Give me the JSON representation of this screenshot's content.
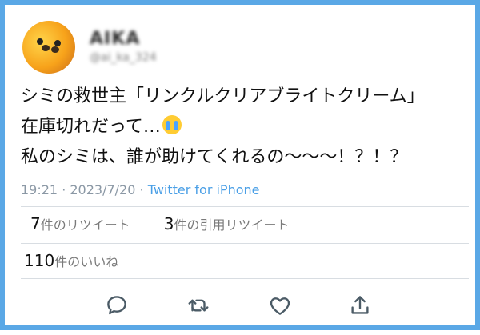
{
  "author": {
    "display_name": "AIKA",
    "handle": "@ai_ka_324"
  },
  "tweet": {
    "line1": "シミの救世主「リンクルクリアブライトクリーム」",
    "line2": "在庫切れだって…",
    "emoji": "loudly-crying-face",
    "line3": "私のシミは、誰が助けてくれるの〜〜〜！？！？"
  },
  "meta": {
    "time": "19:21",
    "date": "2023/7/20",
    "source": "Twitter for iPhone"
  },
  "stats": {
    "retweets_count": "7",
    "retweets_label": "件のリツイート",
    "quotes_count": "3",
    "quotes_label": "件の引用リツイート",
    "likes_count": "110",
    "likes_label": "件のいいね"
  },
  "actions": [
    {
      "icon": "reply-icon"
    },
    {
      "icon": "retweet-icon"
    },
    {
      "icon": "like-icon"
    },
    {
      "icon": "share-icon"
    }
  ],
  "colors": {
    "frame": "#5aa8e6",
    "link": "#4a9fe6",
    "icon": "#4b5b66"
  }
}
